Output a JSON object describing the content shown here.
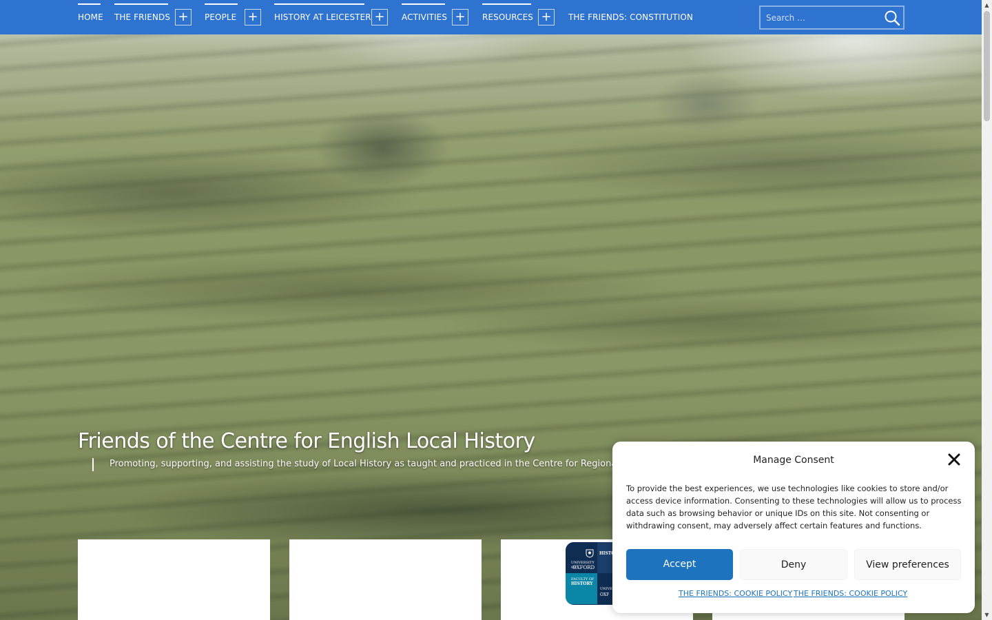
{
  "nav": {
    "items": [
      {
        "label": "HOME",
        "has_submenu": false
      },
      {
        "label": "THE FRIENDS",
        "has_submenu": true
      },
      {
        "label": "PEOPLE",
        "has_submenu": true
      },
      {
        "label": "HISTORY AT LEICESTER",
        "has_submenu": true
      },
      {
        "label": "ACTIVITIES",
        "has_submenu": true
      },
      {
        "label": "RESOURCES",
        "has_submenu": true
      },
      {
        "label": "THE FRIENDS: CONSTITUTION",
        "has_submenu": false
      }
    ],
    "expand_symbol": "+",
    "background_color": "#2f73d0"
  },
  "search": {
    "placeholder": "Search …",
    "icon": "search-icon"
  },
  "site": {
    "title": "Friends of the Centre for English Local History",
    "tagline": "Promoting, supporting, and assisting the study of Local History as taught and practiced in the Centre for Regional a"
  },
  "cards": {
    "logo_text": {
      "top_left_1": "UNIVERSITY OF",
      "top_left_2": "OXFORD",
      "top_right": "HISTOR",
      "bottom_left_1": "FACULTY OF",
      "bottom_left_2": "HISTORY",
      "bottom_right_1": "UNIVE",
      "bottom_right_2": "OXF"
    }
  },
  "consent": {
    "title": "Manage Consent",
    "body": "To provide the best experiences, we use technologies like cookies to store and/or access device information. Consenting to these technologies will allow us to process data such as browsing behavior or unique IDs on this site. Not consenting or withdrawing consent, may adversely affect certain features and functions.",
    "accept_label": "Accept",
    "deny_label": "Deny",
    "preferences_label": "View preferences",
    "links": [
      "THE FRIENDS: COOKIE POLICY",
      "THE FRIENDS: COOKIE POLICY"
    ],
    "accent_color": "#1e73be"
  }
}
